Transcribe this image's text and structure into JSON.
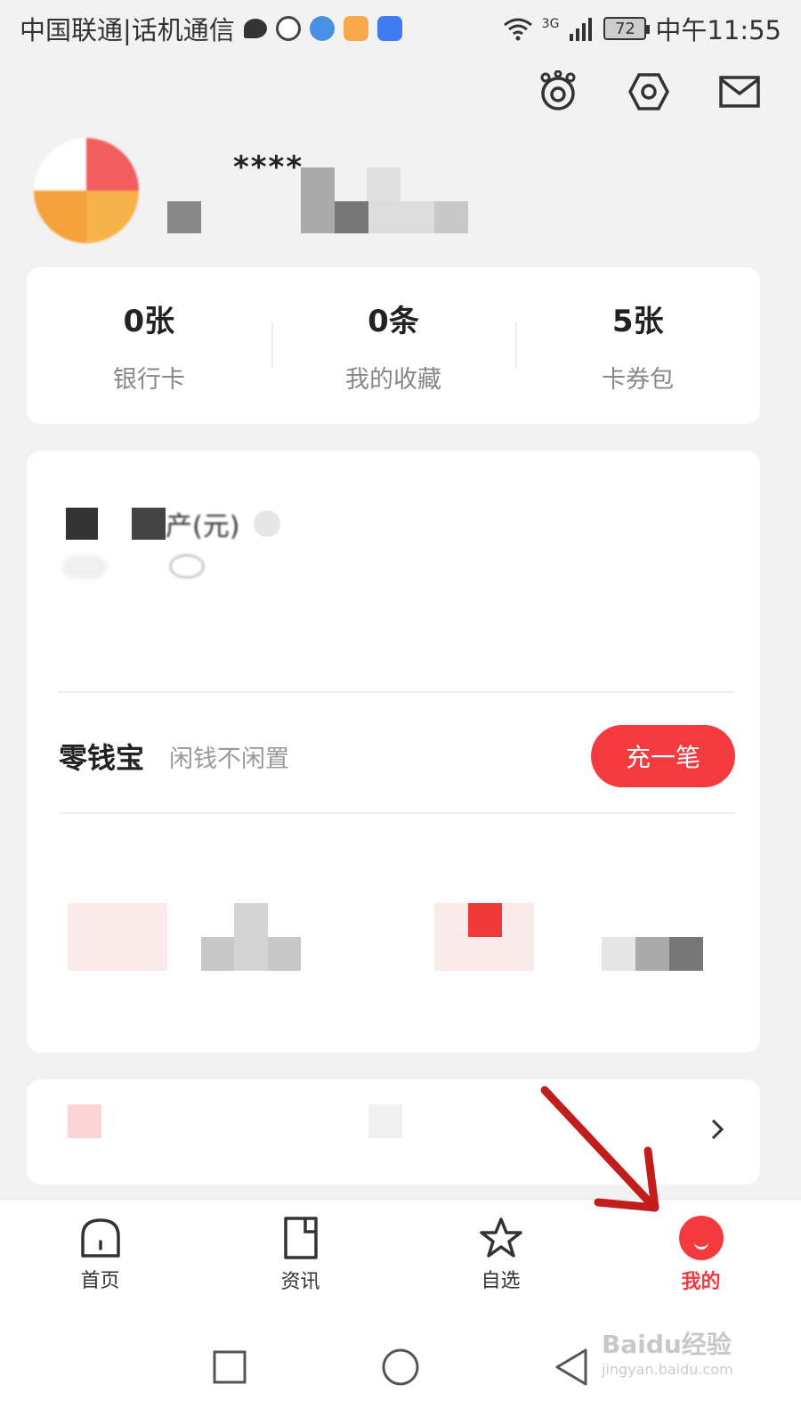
{
  "status_bar": {
    "carrier": "中国联通|话机通信",
    "network": "3G",
    "battery": "72",
    "time": "中午11:55"
  },
  "header": {
    "icons": [
      "avatar-robot-icon",
      "settings-icon",
      "mail-icon"
    ]
  },
  "profile": {
    "username": "****"
  },
  "stats": [
    {
      "value": "0张",
      "label": "银行卡"
    },
    {
      "value": "0条",
      "label": "我的收藏"
    },
    {
      "value": "5张",
      "label": "卡券包"
    }
  ],
  "assets": {
    "title": "产(元)",
    "lingqianbao": {
      "title": "零钱宝",
      "subtitle": "闲钱不闲置",
      "button": "充一笔"
    }
  },
  "bottom_nav": [
    {
      "label": "首页",
      "active": false
    },
    {
      "label": "资讯",
      "active": false
    },
    {
      "label": "自选",
      "active": false
    },
    {
      "label": "我的",
      "active": true
    }
  ],
  "watermark": {
    "text": "Baidu经验",
    "sub": "jingyan.baidu.com"
  },
  "colors": {
    "accent": "#f33a3f",
    "background": "#f2f2f2",
    "arrow": "#c21d1d"
  }
}
